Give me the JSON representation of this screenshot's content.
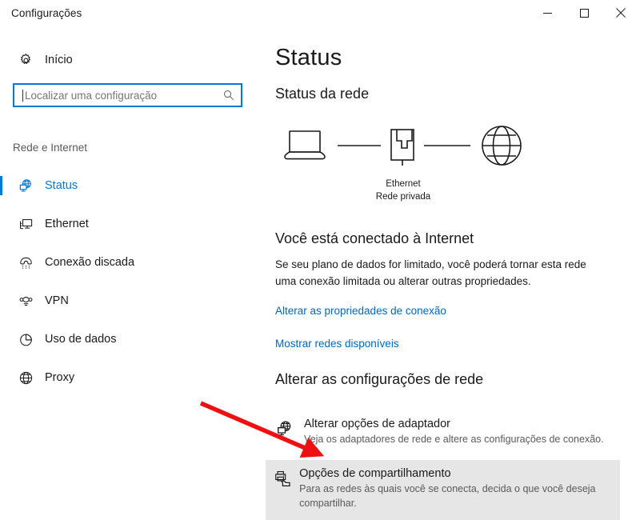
{
  "window": {
    "title": "Configurações",
    "controls": [
      {
        "name": "minimize",
        "glyph": "minimize-icon"
      },
      {
        "name": "maximize",
        "glyph": "maximize-icon"
      },
      {
        "name": "close",
        "glyph": "close-icon"
      }
    ]
  },
  "sidebar": {
    "home": {
      "label": "Início",
      "icon": "gear-icon"
    },
    "search": {
      "value": "",
      "placeholder": "Localizar uma configuração",
      "icon": "search-icon"
    },
    "section_label": "Rede e Internet",
    "items": [
      {
        "label": "Status",
        "icon": "network-status-icon",
        "selected": true
      },
      {
        "label": "Ethernet",
        "icon": "ethernet-monitor-icon",
        "selected": false
      },
      {
        "label": "Conexão discada",
        "icon": "dialup-phone-icon",
        "selected": false
      },
      {
        "label": "VPN",
        "icon": "vpn-icon",
        "selected": false
      },
      {
        "label": "Uso de dados",
        "icon": "pie-chart-icon",
        "selected": false
      },
      {
        "label": "Proxy",
        "icon": "globe-icon",
        "selected": false
      }
    ]
  },
  "main": {
    "page_title": "Status",
    "network_status_heading": "Status da rede",
    "diagram": {
      "device_icon": "laptop-icon",
      "adapter_icon": "ethernet-port-icon",
      "internet_icon": "globe-icon",
      "caption_line1": "Ethernet",
      "caption_line2": "Rede privada"
    },
    "connected_heading": "Você está conectado à Internet",
    "connected_description": "Se seu plano de dados for limitado, você poderá tornar esta rede uma conexão limitada ou alterar outras propriedades.",
    "links": [
      {
        "label": "Alterar as propriedades de conexão"
      },
      {
        "label": "Mostrar redes disponíveis"
      }
    ],
    "change_settings_heading": "Alterar as configurações de rede",
    "options": [
      {
        "icon": "adapter-globe-icon",
        "title": "Alterar opções de adaptador",
        "subtitle": "Veja os adaptadores de rede e altere as configurações de conexão.",
        "highlighted": false
      },
      {
        "icon": "sharing-printer-icon",
        "title": "Opções de compartilhamento",
        "subtitle": "Para as redes às quais você se conecta, decida o que você deseja compartilhar.",
        "highlighted": true
      }
    ]
  },
  "annotation": {
    "arrow": {
      "color": "#ee1111",
      "name": "red-pointer-arrow"
    }
  },
  "colors": {
    "accent": "#0078d7",
    "link": "#0067c0",
    "highlight_row": "#e6e6e6",
    "muted_text": "#5a5a5a",
    "annotation_red": "#ee1111"
  }
}
